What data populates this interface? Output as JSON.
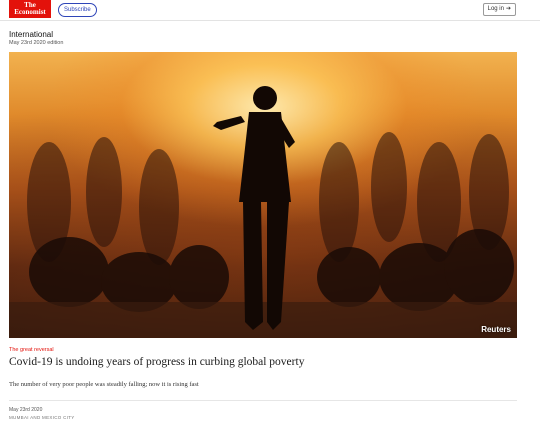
{
  "header": {
    "logo_line1": "The",
    "logo_line2": "Economist",
    "subscribe_label": "Subscribe",
    "login_label": "Log in",
    "login_icon": "arrow-right-icon"
  },
  "article": {
    "section": "International",
    "edition": "May 23rd 2020 edition",
    "image_credit": "Reuters",
    "kicker": "The great reversal",
    "headline": "Covid-19 is undoing years of progress in curbing global poverty",
    "standfirst": "The number of very poor people was steadily falling; now it is rising fast",
    "date": "May 23rd 2020",
    "dateline": "MUMBAI AND MEXICO CITY"
  },
  "colors": {
    "brand_red": "#e3120b",
    "subscribe_blue": "#2e45b8"
  }
}
